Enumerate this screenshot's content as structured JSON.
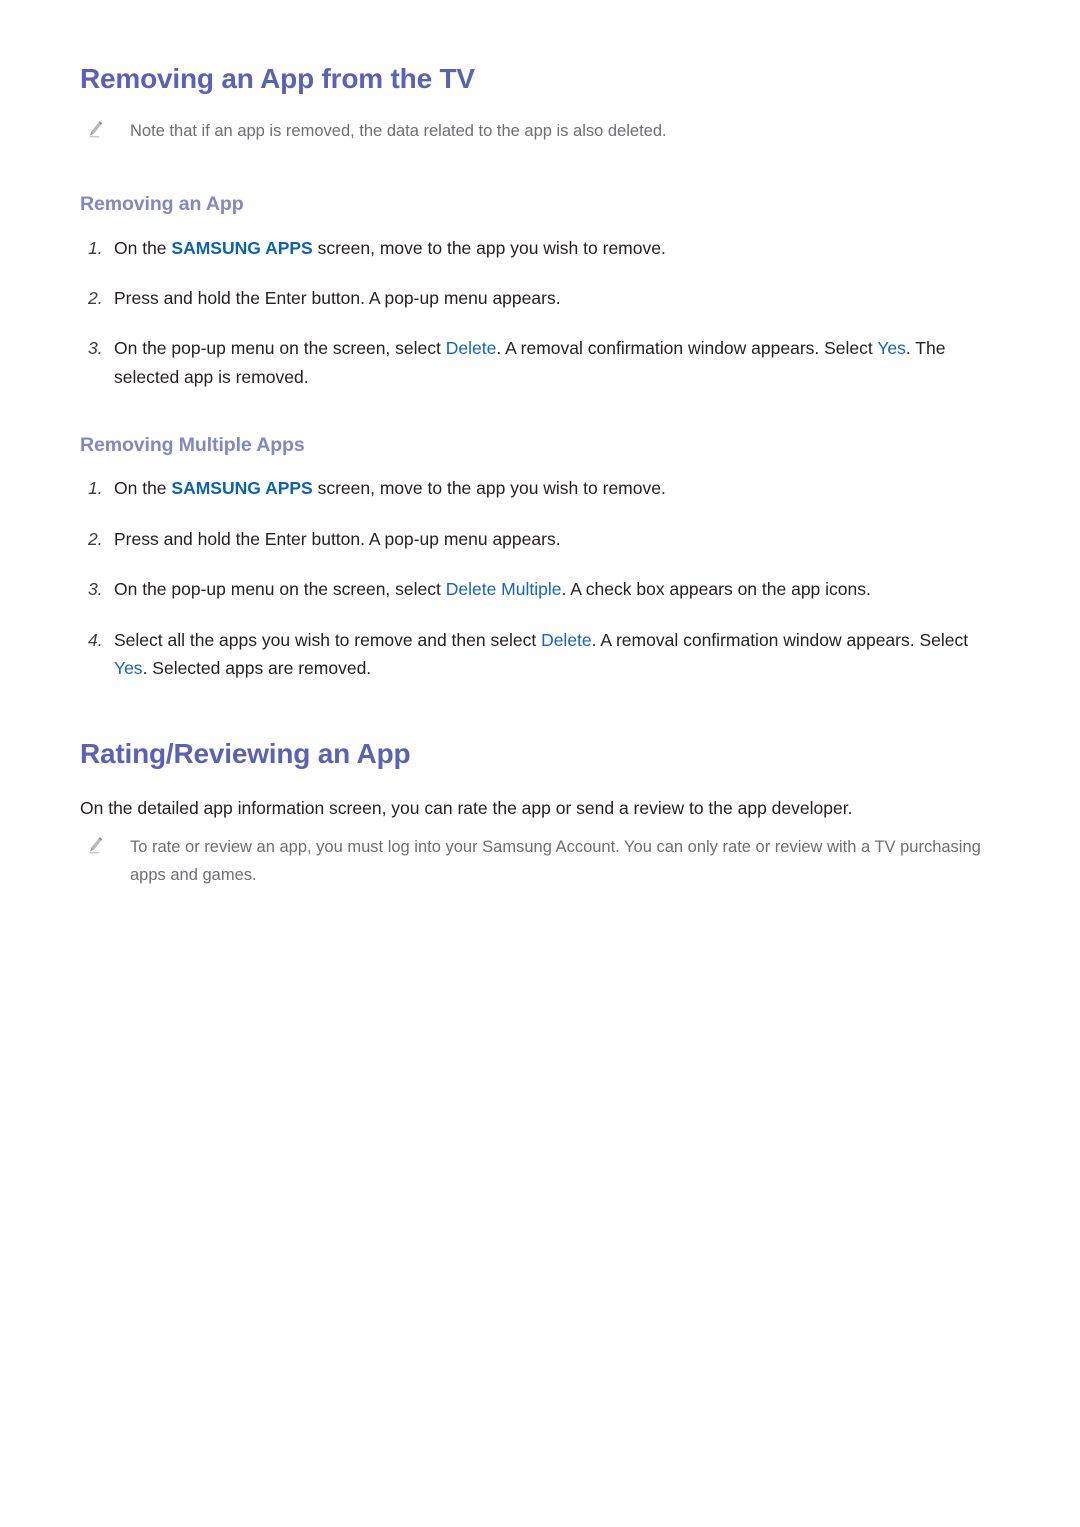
{
  "colors": {
    "h1": "#5a62b5",
    "h2": "#8287c6",
    "body_text": "#241f20",
    "note_text": "#6e6e73",
    "keyword_blue": "#1565c0",
    "keyword_blue_bold": "#0c63b6",
    "page_background": "#ffffff"
  },
  "icons": {
    "note_bullet": "pencil-icon"
  },
  "section_remove_app": {
    "heading": "Removing an App from the TV",
    "note": "Note that if an app is removed, the data related to the app is also deleted.",
    "sub_single": {
      "heading": "Removing an App",
      "steps": [
        {
          "number": "1.",
          "parts": [
            {
              "text": "On the ",
              "style": "plain"
            },
            {
              "text": "SAMSUNG APPS",
              "style": "keyword-bold"
            },
            {
              "text": " screen, move to the app you wish to remove.",
              "style": "plain"
            }
          ]
        },
        {
          "number": "2.",
          "parts": [
            {
              "text": "Press and hold the Enter button. A pop-up menu appears.",
              "style": "plain"
            }
          ]
        },
        {
          "number": "3.",
          "parts": [
            {
              "text": "On the pop-up menu on the screen, select ",
              "style": "plain"
            },
            {
              "text": "Delete",
              "style": "keyword"
            },
            {
              "text": ". A removal confirmation window appears. Select ",
              "style": "plain"
            },
            {
              "text": "Yes",
              "style": "keyword"
            },
            {
              "text": ". The selected app is removed.",
              "style": "plain"
            }
          ]
        }
      ]
    },
    "sub_multiple": {
      "heading": "Removing Multiple Apps",
      "steps": [
        {
          "number": "1.",
          "parts": [
            {
              "text": "On the ",
              "style": "plain"
            },
            {
              "text": "SAMSUNG APPS",
              "style": "keyword-bold"
            },
            {
              "text": " screen, move to the app you wish to remove.",
              "style": "plain"
            }
          ]
        },
        {
          "number": "2.",
          "parts": [
            {
              "text": "Press and hold the Enter button. A pop-up menu appears.",
              "style": "plain"
            }
          ]
        },
        {
          "number": "3.",
          "parts": [
            {
              "text": "On the pop-up menu on the screen, select ",
              "style": "plain"
            },
            {
              "text": "Delete Multiple",
              "style": "keyword"
            },
            {
              "text": ". A check box appears on the app icons.",
              "style": "plain"
            }
          ]
        },
        {
          "number": "4.",
          "parts": [
            {
              "text": "Select all the apps you wish to remove and then select ",
              "style": "plain"
            },
            {
              "text": "Delete",
              "style": "keyword"
            },
            {
              "text": ". A removal confirmation window appears. Select ",
              "style": "plain"
            },
            {
              "text": "Yes",
              "style": "keyword"
            },
            {
              "text": ". Selected apps are removed.",
              "style": "plain"
            }
          ]
        }
      ]
    }
  },
  "section_rating": {
    "heading": "Rating/Reviewing an App",
    "paragraph": "On the detailed app information screen, you can rate the app or send a review to the app developer.",
    "note": "To rate or review an app, you must log into your Samsung Account. You can only rate or review with a TV purchasing apps and games."
  }
}
